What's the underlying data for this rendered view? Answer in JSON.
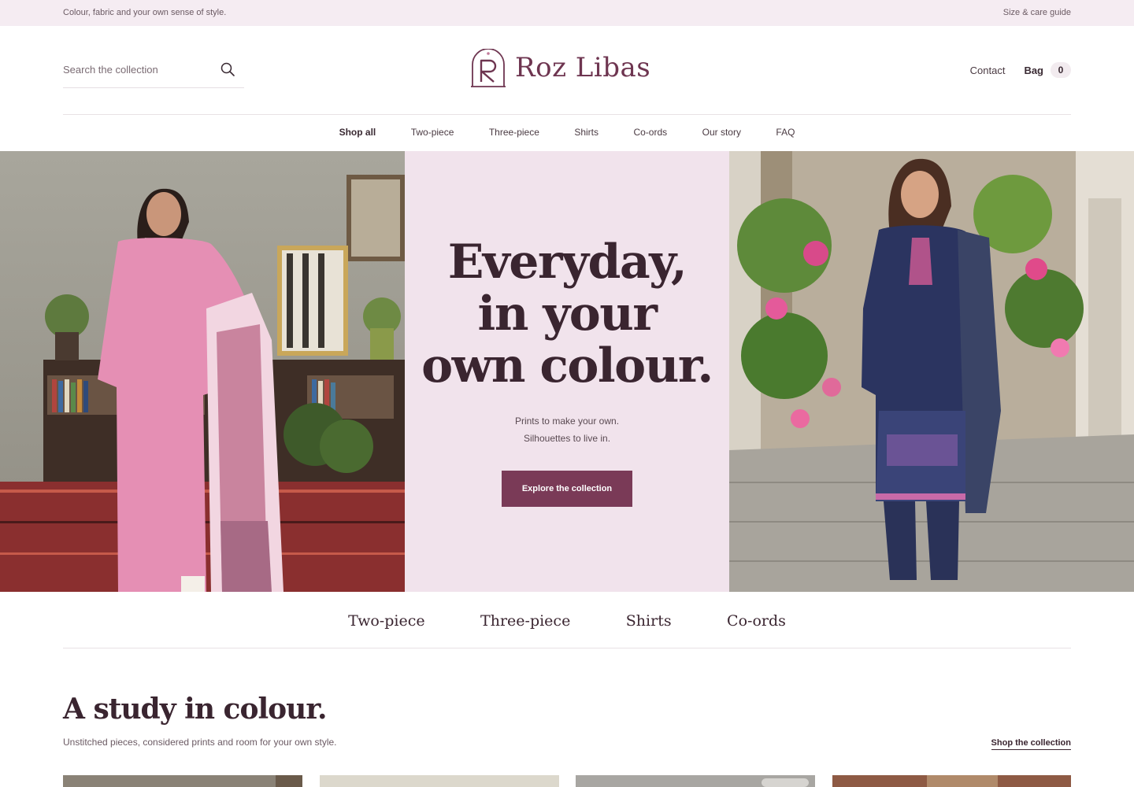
{
  "announcement": {
    "tagline": "Colour, fabric and your own sense of style.",
    "size_guide_link": "Size & care guide"
  },
  "header": {
    "search_placeholder": "Search the collection",
    "brand_name": "Roz Libas",
    "contact_label": "Contact",
    "bag_label": "Bag",
    "bag_count": "0"
  },
  "nav": {
    "items": [
      "Shop all",
      "Two-piece",
      "Three-piece",
      "Shirts",
      "Co-ords",
      "Our story",
      "FAQ"
    ],
    "active": "Shop all"
  },
  "hero": {
    "title": "Everyday,\nin your\nown colour.",
    "subtitle_line1": "Prints to make your own.",
    "subtitle_line2": "Silhouettes to live in.",
    "cta_label": "Explore the collection"
  },
  "categories": [
    "Two-piece",
    "Three-piece",
    "Shirts",
    "Co-ords"
  ],
  "study": {
    "title": "A study in colour.",
    "subtitle": "Unstitched pieces, considered prints and room for your own style.",
    "shop_link": "Shop the collection"
  },
  "colors": {
    "accent": "#7a3a57",
    "brand": "#6e3550",
    "hero_panel": "#f1e3ec",
    "announcement_bg": "#f5ecf2"
  }
}
